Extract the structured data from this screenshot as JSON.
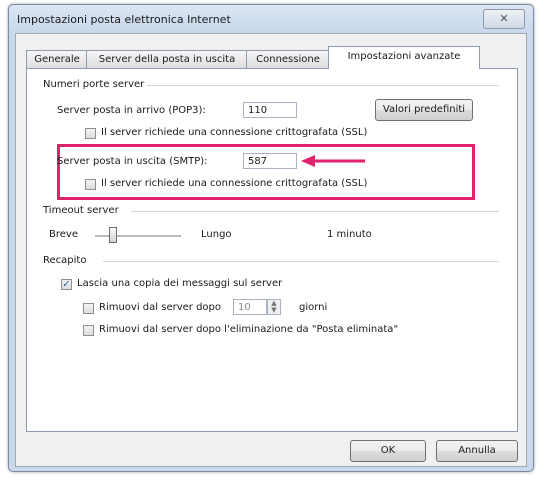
{
  "window": {
    "title": "Impostazioni posta elettronica Internet",
    "close_glyph": "✕"
  },
  "tabs": [
    {
      "label": "Generale"
    },
    {
      "label": "Server della posta in uscita"
    },
    {
      "label": "Connessione"
    },
    {
      "label": "Impostazioni avanzate"
    }
  ],
  "active_tab": "Impostazioni avanzate",
  "server_ports": {
    "section_label": "Numeri porte server",
    "incoming_label": "Server posta in arrivo (POP3):",
    "incoming_value": "110",
    "incoming_ssl_label": "Il server richiede una connessione crittografata (SSL)",
    "incoming_ssl_checked": false,
    "defaults_button": "Valori predefiniti",
    "outgoing_label": "Server posta in uscita (SMTP):",
    "outgoing_value": "587",
    "outgoing_ssl_label": "Il server richiede una connessione crittografata (SSL)",
    "outgoing_ssl_checked": false
  },
  "timeout": {
    "section_label": "Timeout server",
    "short_label": "Breve",
    "long_label": "Lungo",
    "value_label": "1 minuto"
  },
  "delivery": {
    "section_label": "Recapito",
    "leave_copy_label": "Lascia una copia dei messaggi sul server",
    "leave_copy_checked": true,
    "remove_after_label": "Rimuovi dal server dopo",
    "remove_after_checked": false,
    "days_value": "10",
    "days_unit": "giorni",
    "remove_deleted_label": "Rimuovi dal server dopo l'eliminazione da \"Posta eliminata\"",
    "remove_deleted_checked": false
  },
  "buttons": {
    "ok": "OK",
    "cancel": "Annulla"
  },
  "colors": {
    "annotation": "#e0216b"
  }
}
